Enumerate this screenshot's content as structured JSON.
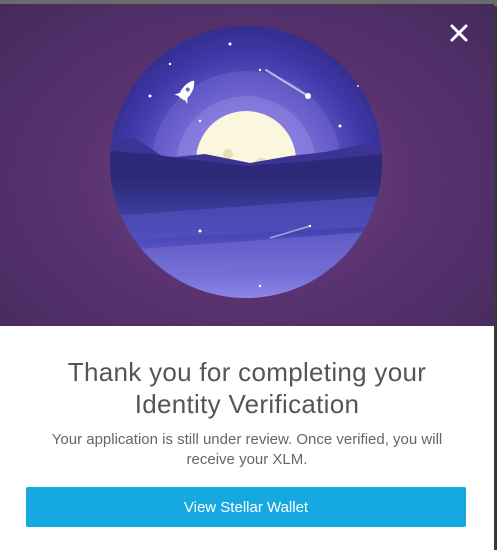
{
  "modal": {
    "close_icon": "close-icon",
    "title": "Thank you for completing your Identity Verification",
    "message": "Your application is still under review. Once verified, you will receive your XLM.",
    "cta_label": "View Stellar Wallet",
    "accent_color": "#16a9e1",
    "hero_color": "#5a3370"
  }
}
